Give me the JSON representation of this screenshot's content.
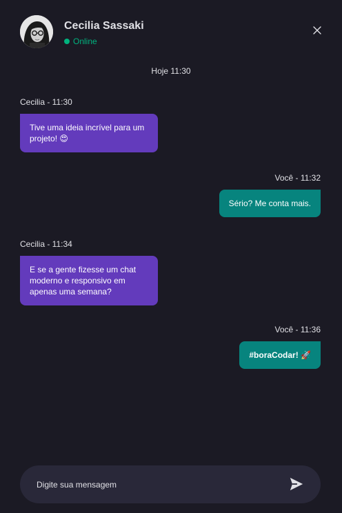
{
  "contact": {
    "name": "Cecilia Sassaki",
    "status": "Online"
  },
  "colors": {
    "background": "#1b1a24",
    "incoming": "#633bbc",
    "outgoing": "#07847e",
    "online": "#00b37e",
    "composer": "#292839"
  },
  "icons": {
    "close": "close-icon",
    "send": "send-icon"
  },
  "day_divider": "Hoje 11:30",
  "messages": [
    {
      "meta": "Cecilia - 11:30",
      "text": "Tive uma ideia incrível para um projeto! 😍",
      "direction": "incoming"
    },
    {
      "meta": "Você - 11:32",
      "text": "Sério? Me conta mais.",
      "direction": "outgoing"
    },
    {
      "meta": "Cecilia - 11:34",
      "text": "E se a gente fizesse um chat moderno e responsivo em apenas uma semana?",
      "direction": "incoming"
    },
    {
      "meta": "Você - 11:36",
      "text": "#boraCodar! 🚀",
      "direction": "outgoing"
    }
  ],
  "composer": {
    "placeholder": "Digite sua mensagem",
    "value": ""
  }
}
